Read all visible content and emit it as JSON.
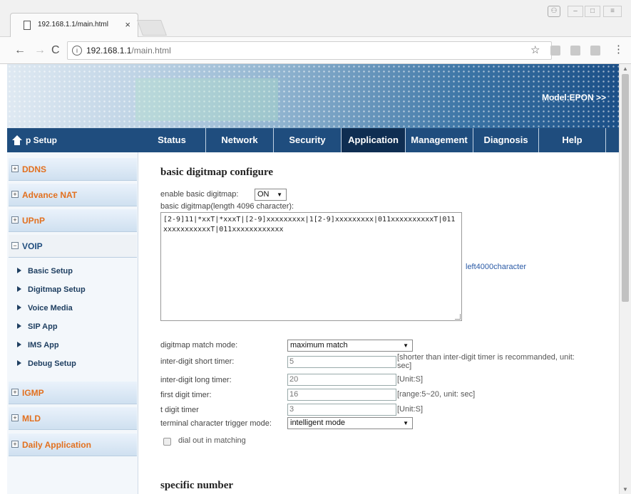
{
  "browser": {
    "tab_title": "192.168.1.1/main.html",
    "url_host": "192.168.1.1",
    "url_path": "/main.html"
  },
  "banner": {
    "model": "Model:EPON >>"
  },
  "menu": [
    "Status",
    "Network",
    "Security",
    "Application",
    "Management",
    "Diagnosis",
    "Help"
  ],
  "menu_active": "Application",
  "sidebar": {
    "header": "p Setup",
    "sections": [
      {
        "label": "DDNS",
        "state": "+"
      },
      {
        "label": "Advance NAT",
        "state": "+"
      },
      {
        "label": "UPnP",
        "state": "+"
      },
      {
        "label": "VOIP",
        "state": "−"
      }
    ],
    "voip_items": [
      "Basic Setup",
      "Digitmap Setup",
      "Voice Media",
      "SIP App",
      "IMS App",
      "Debug Setup"
    ],
    "sections_after": [
      {
        "label": "IGMP",
        "state": "+"
      },
      {
        "label": "MLD",
        "state": "+"
      },
      {
        "label": "Daily Application",
        "state": "+"
      }
    ]
  },
  "content": {
    "title": "basic digitmap configure",
    "enable_label": "enable basic digitmap:",
    "enable_value": "ON",
    "digitmap_label": "basic digitmap(length 4096 character):",
    "digitmap_value": "[2-9]11|*xxT|*xxxT|[2-9]xxxxxxxxx|1[2-9]xxxxxxxxx|011xxxxxxxxxxT|011xxxxxxxxxxxT|011xxxxxxxxxxxx",
    "left_count": "left4000character",
    "match_mode_label": "digitmap match mode:",
    "match_mode_value": "maximum match",
    "short_timer_label": "inter-digit short timer:",
    "short_timer_value": "5",
    "short_timer_hint": "[shorter than inter-digit timer is recommanded, unit: sec]",
    "long_timer_label": "inter-digit long timer:",
    "long_timer_value": "20",
    "long_timer_hint": "[Unit:S]",
    "first_timer_label": "first digit timer:",
    "first_timer_value": "16",
    "first_timer_hint": "[range:5~20, unit: sec]",
    "t_timer_label": "t digit timer",
    "t_timer_value": "3",
    "t_timer_hint": "[Unit:S]",
    "trigger_label": "terminal character trigger mode:",
    "trigger_value": "intelligent mode",
    "dial_out_label": "dial out in matching",
    "specific_title": "specific number"
  },
  "colors": {
    "menu_bg": "#1f4d7e",
    "menu_active_bg": "#0f2e52",
    "section_label": "#e2701f",
    "link": "#2a5aa6"
  }
}
